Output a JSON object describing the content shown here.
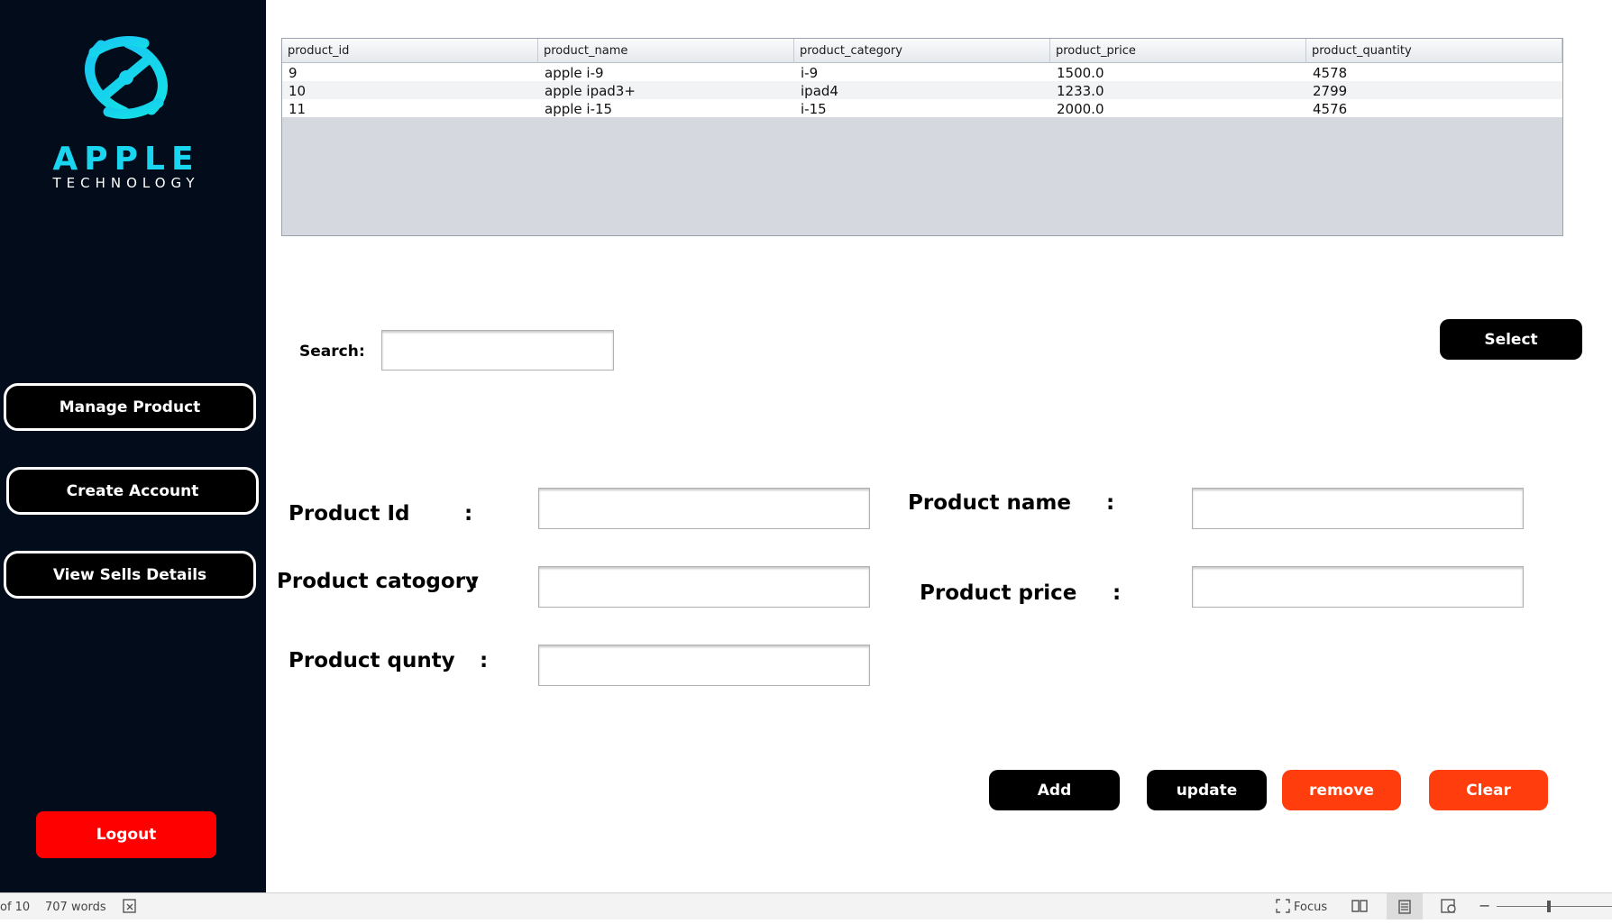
{
  "brand": {
    "title": "APPLE",
    "subtitle": "TECHNOLOGY",
    "accent": "#1ad5ef"
  },
  "nav": {
    "manage_product": "Manage Product",
    "create_account": "Create Account",
    "view_sells": "View Sells Details",
    "logout": "Logout"
  },
  "table": {
    "columns": [
      "product_id",
      "product_name",
      "product_category",
      "product_price",
      "product_quantity"
    ],
    "rows": [
      [
        "9",
        "apple i-9",
        "i-9",
        "1500.0",
        "4578"
      ],
      [
        "10",
        "apple ipad3+",
        "ipad4",
        "1233.0",
        "2799"
      ],
      [
        "11",
        "apple i-15",
        "i-15",
        "2000.0",
        "4576"
      ]
    ]
  },
  "search": {
    "label": "Search",
    "colon": ":",
    "value": "",
    "button": "Select"
  },
  "form": {
    "product_id": {
      "label": "Product Id",
      "colon": ":",
      "value": ""
    },
    "product_name": {
      "label": "Product name",
      "colon": ":",
      "value": ""
    },
    "product_category": {
      "label": "Product catogory",
      "colon": ":",
      "value": ""
    },
    "product_price": {
      "label": "Product price",
      "colon": ":",
      "value": ""
    },
    "product_quantity": {
      "label": "Product qunty",
      "colon": ":",
      "value": ""
    }
  },
  "actions": {
    "add": "Add",
    "update": "update",
    "remove": "remove",
    "clear": "Clear"
  },
  "statusbar": {
    "page": "of 10",
    "words": "707 words",
    "focus": "Focus"
  }
}
